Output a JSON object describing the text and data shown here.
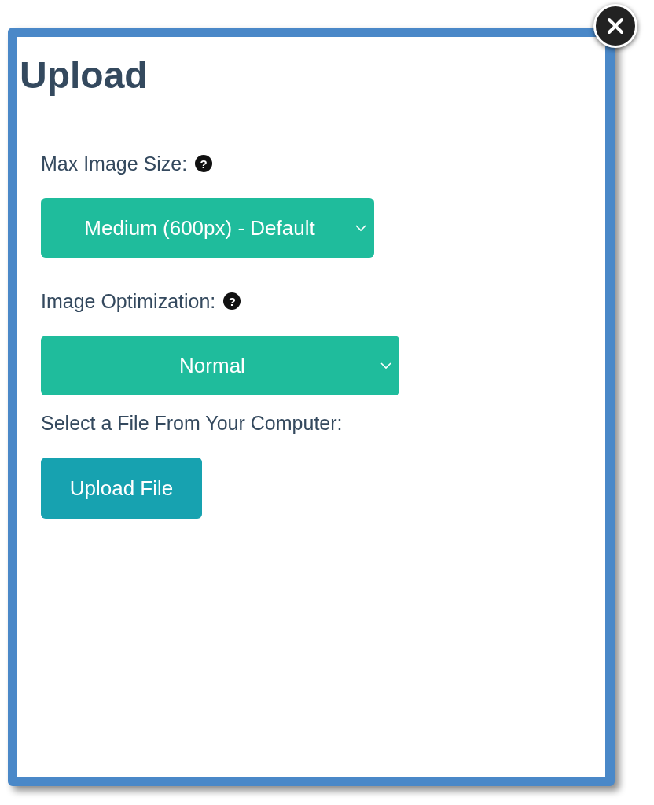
{
  "dialog": {
    "title": "Upload"
  },
  "fields": [
    {
      "kind": "select",
      "label": "Max Image Size:",
      "help": "?",
      "value": "Medium (600px) - Default"
    },
    {
      "kind": "select",
      "label": "Image Optimization:",
      "help": "?",
      "value": "Normal"
    },
    {
      "kind": "file",
      "label": "Select a File From Your Computer:",
      "button": "Upload File"
    }
  ]
}
